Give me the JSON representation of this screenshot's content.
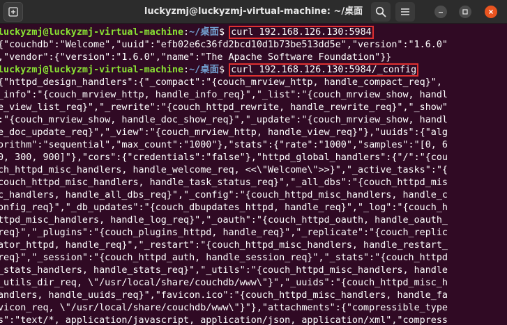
{
  "window": {
    "title": "luckyzmj@luckyzmj-virtual-machine: ~/桌面"
  },
  "icons": {
    "new_tab": "new-tab-icon",
    "search": "search-icon",
    "menu": "hamburger-menu-icon",
    "minimize": "minimize-icon",
    "maximize": "maximize-icon",
    "close": "close-icon"
  },
  "terminal": {
    "prompt": {
      "user_host": "luckyzmj@luckyzmj-virtual-machine",
      "sep": ":",
      "path": "~/桌面",
      "dollar": "$ "
    },
    "command1": "curl 192.168.126.130:5984",
    "output1": [
      "{\"couchdb\":\"Welcome\",\"uuid\":\"efb02e6c36fd2bcd10d1b73be513dd5e\",\"version\":\"1.6.0\"",
      ",\"vendor\":{\"version\":\"1.6.0\",\"name\":\"The Apache Software Foundation\"}}"
    ],
    "command2": "curl 192.168.126.130:5984/_config",
    "output2": [
      "{\"httpd_design_handlers\":{\"_compact\":\"{couch_mrview_http, handle_compact_req}\",",
      "_info\":\"{couch_mrview_http, handle_info_req}\",\"_list\":\"{couch_mrview_show, handl",
      "e_view_list_req}\",\"_rewrite\":\"{couch_httpd_rewrite, handle_rewrite_req}\",\"_show\"",
      ":\"{couch_mrview_show, handle_doc_show_req}\",\"_update\":\"{couch_mrview_show, handl",
      "e_doc_update_req}\",\"_view\":\"{couch_mrview_http, handle_view_req}\"},\"uuids\":{\"alg",
      "orithm\":\"sequential\",\"max_count\":\"1000\"},\"stats\":{\"rate\":\"1000\",\"samples\":\"[0, 6",
      "0, 300, 900]\"},\"cors\":{\"credentials\":\"false\"},\"httpd_global_handlers\":{\"/\":\"{cou",
      "ch_httpd_misc_handlers, handle_welcome_req, <<\\\"Welcome\\\">>}\",\"_active_tasks\":\"{",
      "couch_httpd_misc_handlers, handle_task_status_req}\",\"_all_dbs\":\"{couch_httpd_mis",
      "c_handlers, handle_all_dbs_req}\",\"_config\":\"{couch_httpd_misc_handlers, handle_c",
      "onfig_req}\",\"_db_updates\":\"{couch_dbupdates_httpd, handle_req}\",\"_log\":\"{couch_h",
      "ttpd_misc_handlers, handle_log_req}\",\"_oauth\":\"{couch_httpd_oauth, handle_oauth_",
      "req}\",\"_plugins\":\"{couch_plugins_httpd, handle_req}\",\"_replicate\":\"{couch_replic",
      "ator_httpd, handle_req}\",\"_restart\":\"{couch_httpd_misc_handlers, handle_restart_",
      "req}\",\"_session\":\"{couch_httpd_auth, handle_session_req}\",\"_stats\":\"{couch_httpd",
      "_stats_handlers, handle_stats_req}\",\"_utils\":\"{couch_httpd_misc_handlers, handle",
      "_utils_dir_req, \\\"/usr/local/share/couchdb/www\\\"}\",\"_uuids\":\"{couch_httpd_misc_h",
      "andlers, handle_uuids_req}\",\"favicon.ico\":\"{couch_httpd_misc_handlers, handle_fa",
      "vicon_req, \\\"/usr/local/share/couchdb/www\\\"}\"},\"attachments\":{\"compressible_type",
      "s\":\"text/*, application/javascript, application/json, application/xml\",\"compress"
    ]
  }
}
